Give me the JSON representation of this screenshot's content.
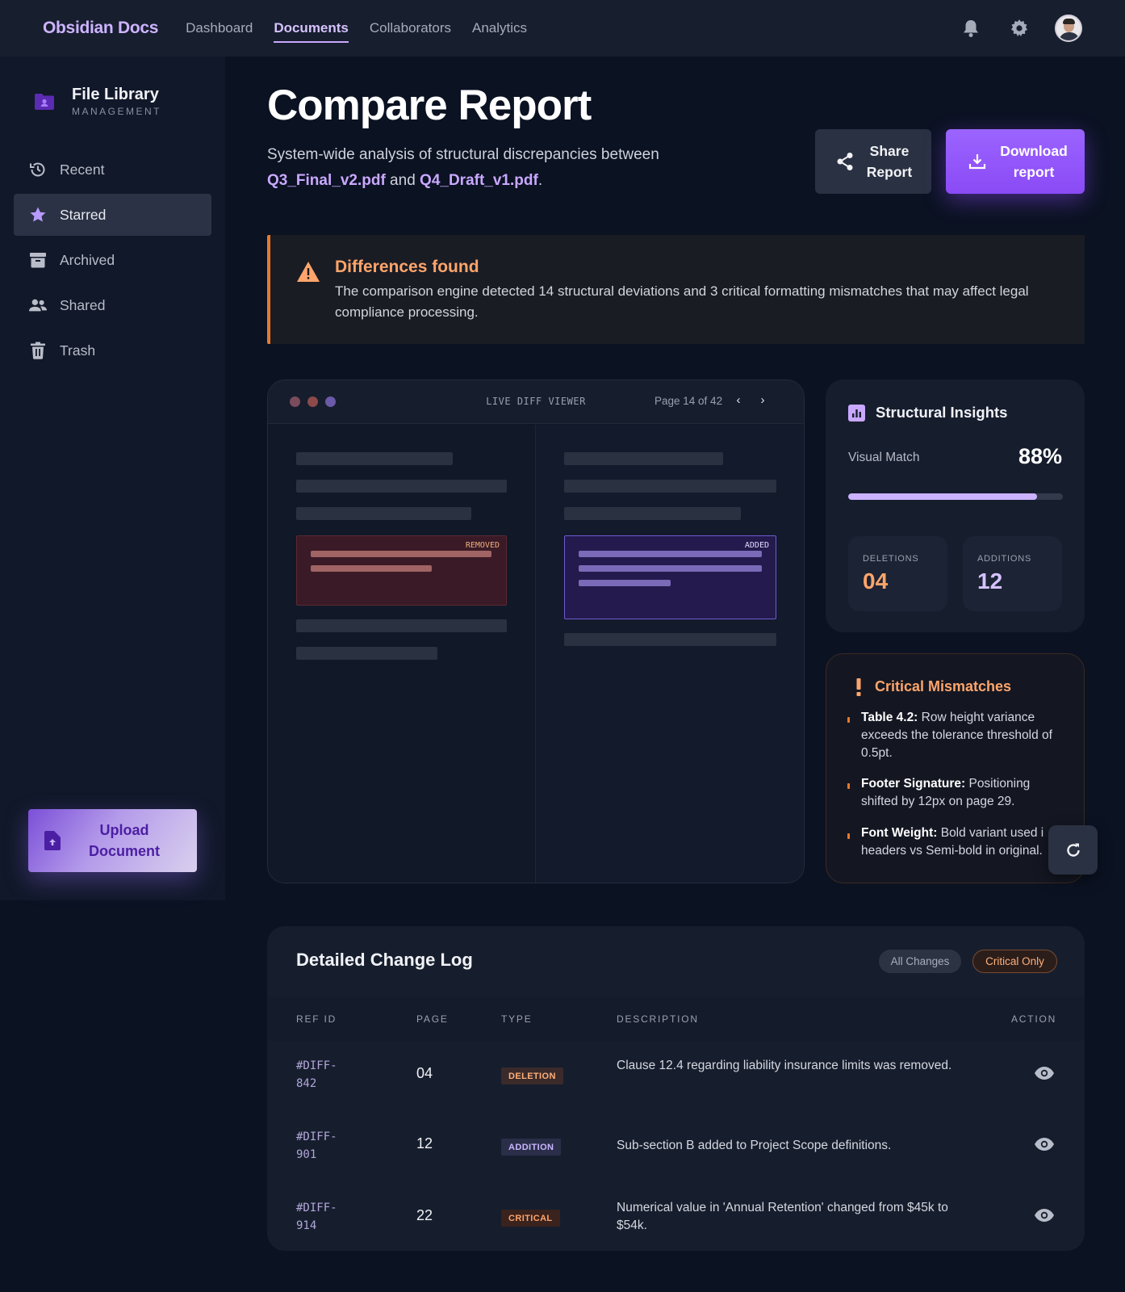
{
  "nav": {
    "brand": "Obsidian Docs",
    "links": [
      "Dashboard",
      "Documents",
      "Collaborators",
      "Analytics"
    ],
    "active": "Documents"
  },
  "sidebar": {
    "title": "File Library",
    "subtitle": "MANAGEMENT",
    "items": [
      {
        "label": "Recent",
        "icon": "history-icon"
      },
      {
        "label": "Starred",
        "icon": "star-icon",
        "active": true
      },
      {
        "label": "Archived",
        "icon": "archive-icon"
      },
      {
        "label": "Shared",
        "icon": "people-icon"
      },
      {
        "label": "Trash",
        "icon": "trash-icon"
      }
    ],
    "upload_label": "Upload Document"
  },
  "header": {
    "title": "Compare Report",
    "desc_before": "System-wide analysis of structural discrepancies between ",
    "file_a": "Q3_Final_v2.pdf",
    "desc_mid": " and ",
    "file_b": "Q4_Draft_v1.pdf",
    "desc_after": ".",
    "share_label": "Share Report",
    "download_label": "Download report"
  },
  "alert": {
    "title": "Differences found",
    "text": "The comparison engine detected 14 structural deviations and 3 critical formatting mismatches that may affect legal compliance processing."
  },
  "viewer": {
    "title": "LIVE DIFF VIEWER",
    "page_text": "Page 14 of 42",
    "prev": "‹",
    "next": "›",
    "removed_tag": "REMOVED",
    "added_tag": "ADDED"
  },
  "insights": {
    "title": "Structural Insights",
    "visual_match_label": "Visual Match",
    "visual_match_value": "88%",
    "visual_match_fraction": 0.88,
    "deletions_label": "DELETIONS",
    "deletions_value": "04",
    "additions_label": "ADDITIONS",
    "additions_value": "12"
  },
  "critical": {
    "title": "Critical Mismatches",
    "items": [
      {
        "bold": "Table 4.2:",
        "text": " Row height variance exceeds the tolerance threshold of 0.5pt."
      },
      {
        "bold": "Footer Signature:",
        "text": " Positioning shifted by 12px on page 29."
      },
      {
        "bold": "Font Weight:",
        "text": " Bold variant used i",
        "text2": "headers vs Semi-bold in original."
      }
    ]
  },
  "changelog": {
    "title": "Detailed Change Log",
    "filter_all": "All Changes",
    "filter_critical": "Critical Only",
    "columns": [
      "REF ID",
      "PAGE",
      "TYPE",
      "DESCRIPTION",
      "ACTION"
    ],
    "rows": [
      {
        "ref_a": "#DIFF-",
        "ref_b": "842",
        "page": "04",
        "type": "DELETION",
        "description": "Clause 12.4 regarding liability insurance limits was removed."
      },
      {
        "ref_a": "#DIFF-",
        "ref_b": "901",
        "page": "12",
        "type": "ADDITION",
        "description": "Sub-section B added to Project Scope definitions."
      },
      {
        "ref_a": "#DIFF-",
        "ref_b": "914",
        "page": "22",
        "type": "CRITICAL",
        "description": "Numerical value in 'Annual Retention' changed from $45k to $54k."
      }
    ]
  },
  "colors": {
    "accent": "#9b64ff",
    "warning": "#e67a2e",
    "background": "#0b1222"
  }
}
